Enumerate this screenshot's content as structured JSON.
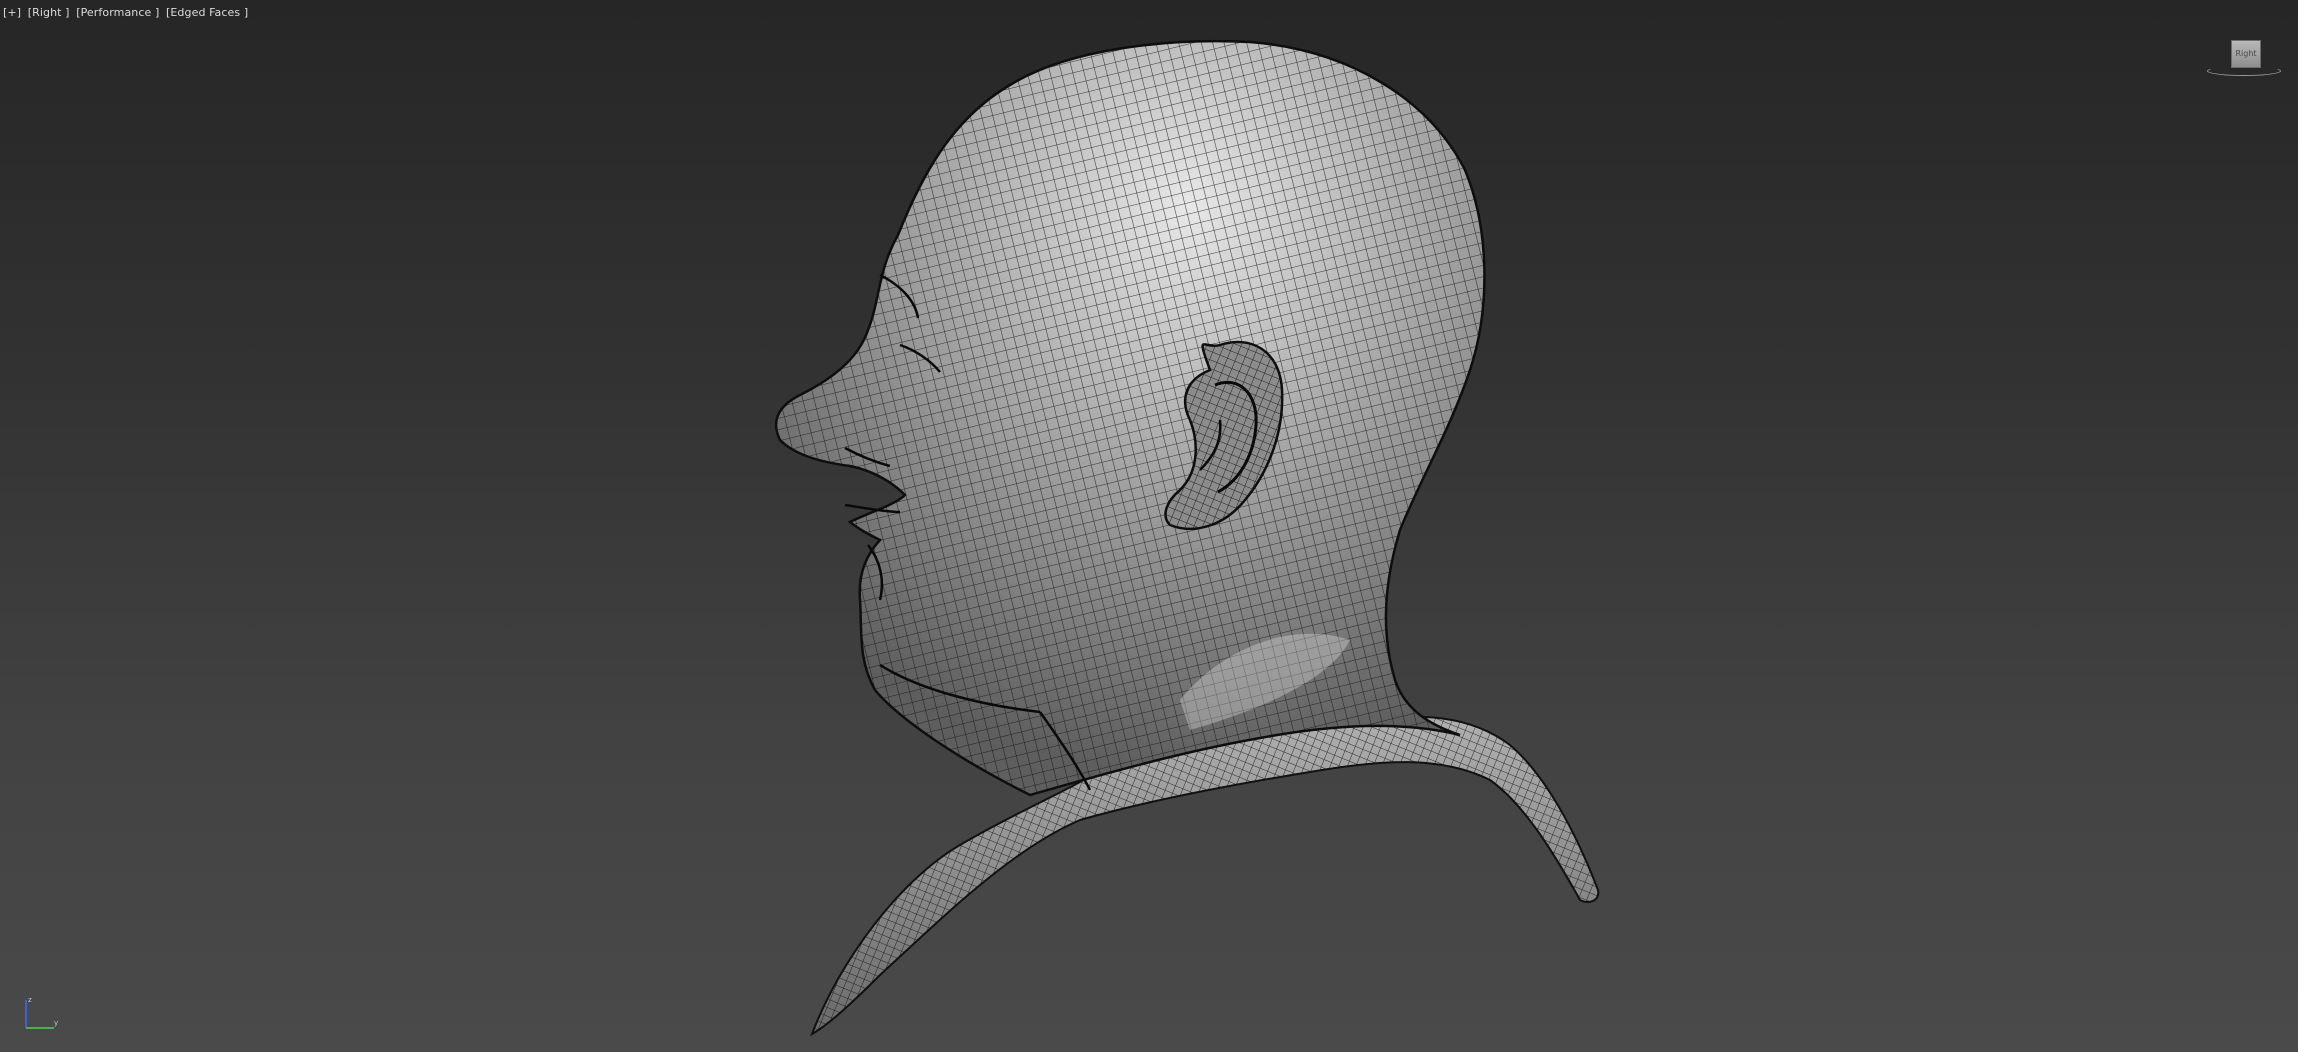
{
  "viewport": {
    "label_plus": "[+]",
    "label_view": "[Right ]",
    "label_mode": "[Performance ]",
    "label_shading": "[Edged Faces ]"
  },
  "viewcube": {
    "face_label": "Right",
    "icon": "viewcube-icon"
  },
  "axis_tripod": {
    "icon": "axis-tripod-icon",
    "axes": [
      "z",
      "y"
    ]
  },
  "scene": {
    "object": "head-mesh",
    "shading": "Edged Faces",
    "colors": {
      "background_top": "#262626",
      "background_bottom": "#4a4a4a",
      "mesh_fill": "#9c9c9c",
      "wire": "#111111"
    }
  }
}
